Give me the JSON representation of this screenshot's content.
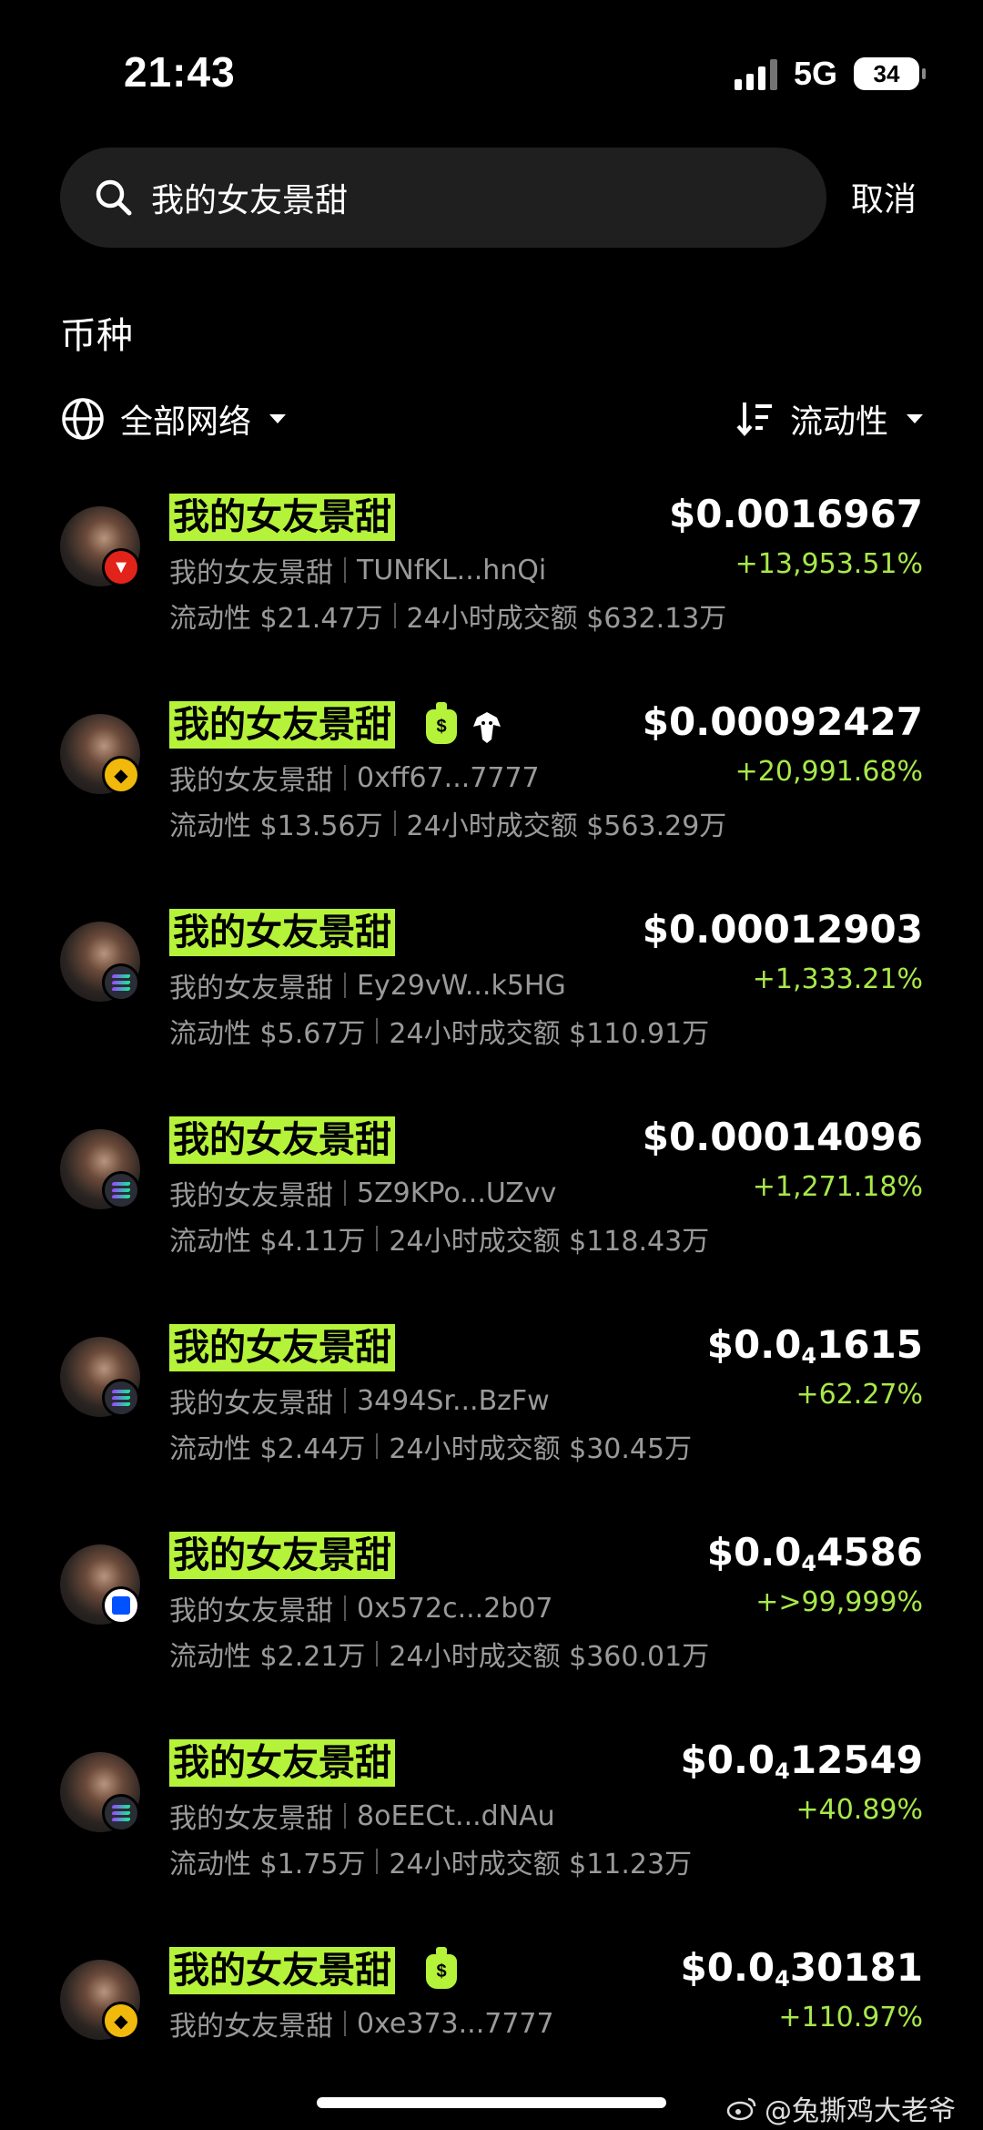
{
  "status_bar": {
    "time": "21:43",
    "network": "5G",
    "battery": "34"
  },
  "search": {
    "value": "我的女友景甜",
    "cancel_label": "取消"
  },
  "section_title": "币种",
  "filters": {
    "network_label": "全部网络",
    "sort_label": "流动性"
  },
  "tokens": [
    {
      "name": "我的女友景甜",
      "label": "我的女友景甜",
      "address": "TUNfKL...hnQi",
      "liquidity": "流动性 $21.47万",
      "volume": "24小时成交额 $632.13万",
      "price": "$0.0016967",
      "change": "+13,953.51%",
      "chain": "tron-icon"
    },
    {
      "name": "我的女友景甜",
      "label": "我的女友景甜",
      "address": "0xff67...7777",
      "liquidity": "流动性 $13.56万",
      "volume": "24小时成交额 $563.29万",
      "price": "$0.00092427",
      "change": "+20,991.68%",
      "chain": "bnb-icon",
      "extras": [
        "moneybag-icon",
        "eagle-icon"
      ]
    },
    {
      "name": "我的女友景甜",
      "label": "我的女友景甜",
      "address": "Ey29vW...k5HG",
      "liquidity": "流动性 $5.67万",
      "volume": "24小时成交额 $110.91万",
      "price": "$0.00012903",
      "change": "+1,333.21%",
      "chain": "solana-icon"
    },
    {
      "name": "我的女友景甜",
      "label": "我的女友景甜",
      "address": "5Z9KPo...UZvv",
      "liquidity": "流动性 $4.11万",
      "volume": "24小时成交额 $118.43万",
      "price": "$0.00014096",
      "change": "+1,271.18%",
      "chain": "solana-icon"
    },
    {
      "name": "我的女友景甜",
      "label": "我的女友景甜",
      "address": "3494Sr...BzFw",
      "liquidity": "流动性 $2.44万",
      "volume": "24小时成交额 $30.45万",
      "price_prefix": "$0.0",
      "price_sub": "4",
      "price_rest": "1615",
      "change": "+62.27%",
      "chain": "solana-icon"
    },
    {
      "name": "我的女友景甜",
      "label": "我的女友景甜",
      "address": "0x572c...2b07",
      "liquidity": "流动性 $2.21万",
      "volume": "24小时成交额 $360.01万",
      "price_prefix": "$0.0",
      "price_sub": "4",
      "price_rest": "4586",
      "change": "+>99,999%",
      "chain": "base-icon"
    },
    {
      "name": "我的女友景甜",
      "label": "我的女友景甜",
      "address": "8oEECt...dNAu",
      "liquidity": "流动性 $1.75万",
      "volume": "24小时成交额 $11.23万",
      "price_prefix": "$0.0",
      "price_sub": "4",
      "price_rest": "12549",
      "change": "+40.89%",
      "chain": "solana-icon"
    },
    {
      "name": "我的女友景甜",
      "label": "我的女友景甜",
      "address": "0xe373...7777",
      "price_prefix": "$0.0",
      "price_sub": "4",
      "price_rest": "30181",
      "change": "+110.97%",
      "chain": "bnb-icon",
      "extras": [
        "moneybag-icon"
      ]
    }
  ],
  "watermark": "@兔撕鸡大老爷",
  "colors": {
    "accent_green": "#b5f33a",
    "change_green": "#a8e84b",
    "background": "#000000",
    "muted": "#9a9a9a"
  }
}
